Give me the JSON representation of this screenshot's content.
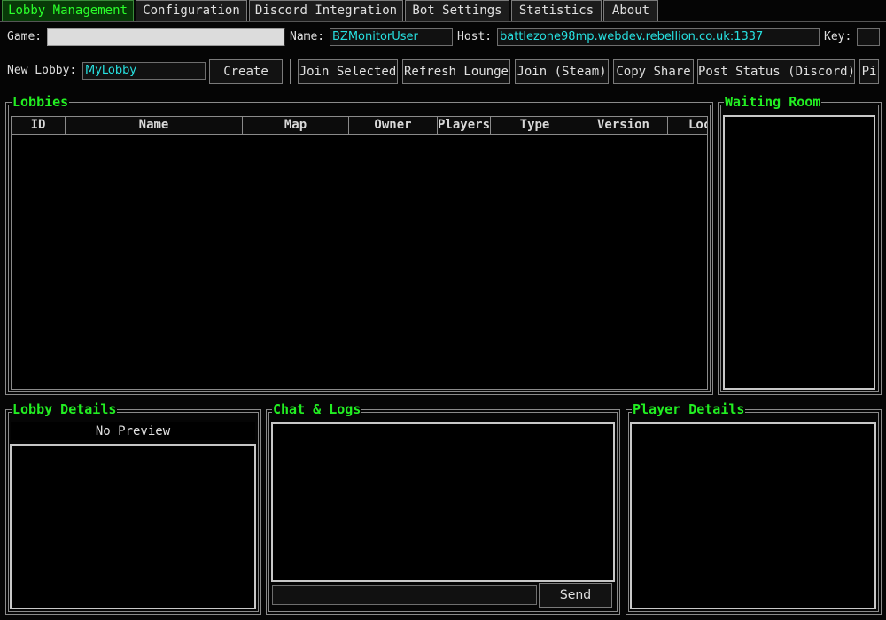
{
  "tabs": [
    {
      "label": "Lobby Management",
      "active": true
    },
    {
      "label": "Configuration",
      "active": false
    },
    {
      "label": "Discord Integration",
      "active": false
    },
    {
      "label": "Bot Settings",
      "active": false
    },
    {
      "label": "Statistics",
      "active": false
    },
    {
      "label": "About",
      "active": false
    }
  ],
  "connection": {
    "game_label": "Game:",
    "game_value": "",
    "name_label": "Name:",
    "name_value": "BZMonitorUser",
    "host_label": "Host:",
    "host_value": "battlezone98mp.webdev.rebellion.co.uk:1337",
    "key_label": "Key:",
    "key_value": ""
  },
  "toolbar": {
    "new_lobby_label": "New Lobby:",
    "new_lobby_value": "MyLobby",
    "create": "Create",
    "join_selected": "Join Selected",
    "refresh_lounge": "Refresh Lounge",
    "join_steam": "Join (Steam)",
    "copy_share": "Copy Share",
    "post_status": "Post Status (Discord)",
    "overflow": "Pi"
  },
  "lobbies": {
    "title": "Lobbies",
    "columns": [
      "ID",
      "Name",
      "Map",
      "Owner",
      "Players",
      "Type",
      "Version",
      "Loc"
    ],
    "rows": []
  },
  "waiting_room": {
    "title": "Waiting Room"
  },
  "lobby_details": {
    "title": "Lobby Details",
    "preview": "No Preview"
  },
  "chat": {
    "title": "Chat & Logs",
    "input_value": "",
    "send": "Send"
  },
  "player_details": {
    "title": "Player Details"
  },
  "colors": {
    "accent": "#22ee22",
    "field_text": "#27e0e0",
    "background": "#050505"
  }
}
